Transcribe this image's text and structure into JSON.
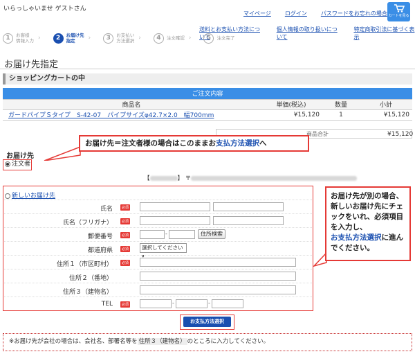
{
  "header": {
    "welcome": "いらっしゃいませ ゲストさん",
    "links": [
      "マイページ",
      "ログイン",
      "パスワードをお忘れの場合"
    ],
    "cart_button": "カートを見る",
    "sub_links": [
      "送料とお支払い方法について",
      "個人情報の取り扱いについて",
      "特定商取引法に基づく表示"
    ]
  },
  "steps": [
    {
      "num": "1",
      "label": "お客様\n情報入力"
    },
    {
      "num": "2",
      "label": "お届け先\n指定"
    },
    {
      "num": "3",
      "label": "お支払い\n方法選択"
    },
    {
      "num": "4",
      "label": "注文確認"
    },
    {
      "num": "5",
      "label": "注文完了"
    }
  ],
  "page_title": "お届け先指定",
  "cart": {
    "section_title": "ショッピングカートの中",
    "bar_title": "ご注文内容",
    "columns": [
      "商品名",
      "単価(税込)",
      "数量",
      "小計"
    ],
    "item": {
      "name": "ガードパイプＳタイプ　S-42-07　パイプサイズφ42.7×2.0　幅700mm",
      "price": "¥15,120",
      "qty": "1",
      "subtotal": "¥15,120"
    },
    "total_label": "商品合計",
    "total_value": "¥15,120"
  },
  "delivery": {
    "section_title": "お届け先",
    "orderer_label": "注文者",
    "orderer_prefix": "【",
    "orderer_mid": "】 〒",
    "new_address_label": "新しいお届け先",
    "fields": {
      "name": "氏名",
      "kana": "氏名（フリガナ）",
      "zip": "郵便番号",
      "pref": "都道府県",
      "addr1": "住所１（市区町村）",
      "addr2": "住所２（番地）",
      "addr3": "住所３（建物名）",
      "tel": "TEL"
    },
    "required": "必須",
    "zip_search": "住所検索",
    "pref_placeholder": "選択してください ▾"
  },
  "callout_top": {
    "before": "お届け先＝注文者様の場合はこのままお",
    "link": "支払方法選択",
    "after": "へ"
  },
  "callout_side": {
    "line1": "お届け先が別の場合、新しいお届け先にチェックをいれ、必須項目を入力し、",
    "link": "お支払方法選択",
    "line2": "に進んでください。"
  },
  "pay_button": "お支払方法選択",
  "notice": {
    "before": "※お届け先が会社の場合は、会社名、部署名等を",
    "em": "住所３（建物名）",
    "after": "のところに入力してください。"
  }
}
